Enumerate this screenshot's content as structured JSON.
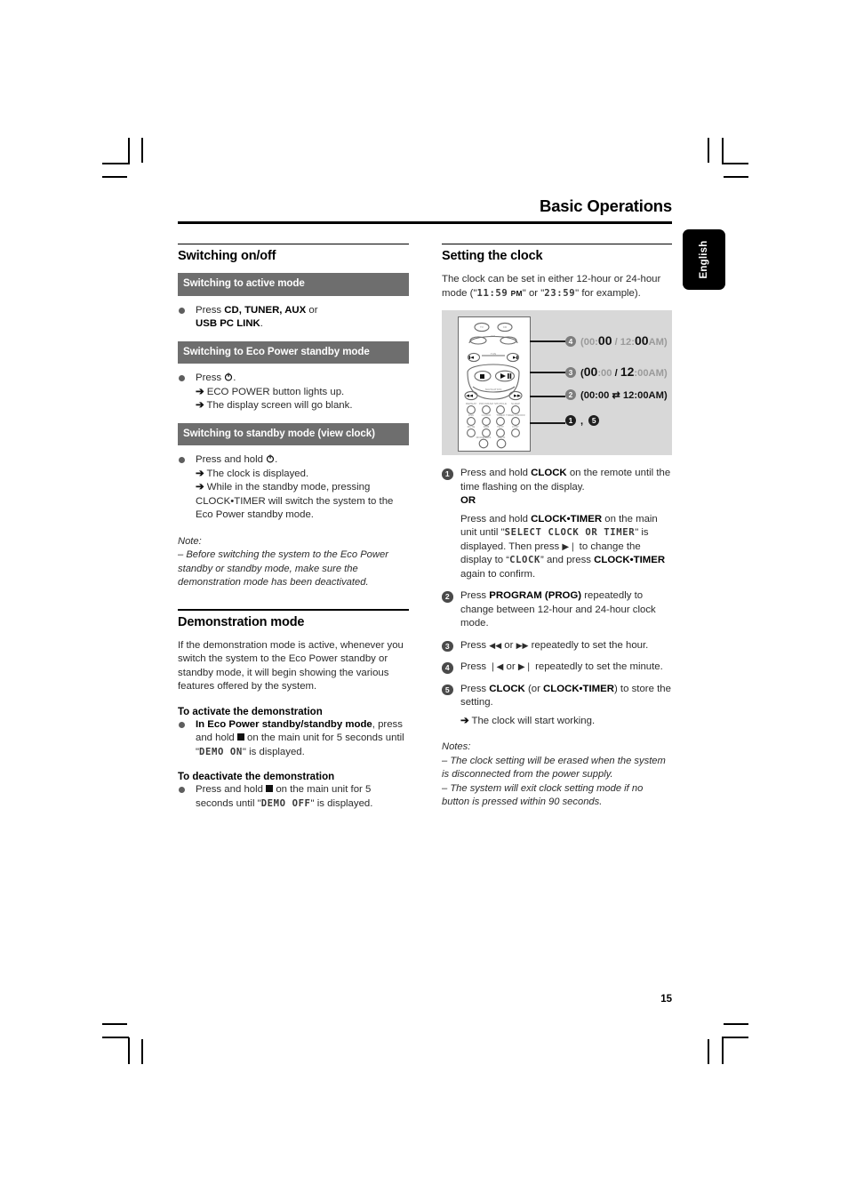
{
  "page": {
    "running_head": "Basic Operations",
    "number": "15",
    "language_tab": "English"
  },
  "left_column": {
    "section_title": "Switching on/off",
    "bars": {
      "active_mode": "Switching to active mode",
      "eco_standby": "Switching to Eco Power standby mode",
      "standby_view_clock": "Switching to standby mode (view clock)"
    },
    "active_mode": {
      "press_label": "Press ",
      "keys": "CD, TUNER, AUX",
      "or": " or",
      "keys2": "USB PC LINK",
      "period": "."
    },
    "eco_standby": {
      "press": "Press ",
      "icon": "power-icon",
      "period": ".",
      "result1": "ECO POWER button lights up.",
      "result2": "The display screen will go blank."
    },
    "standby": {
      "press": "Press and hold ",
      "icon": "power-icon",
      "period": ".",
      "result1": "The clock is displayed.",
      "result2_a": "While in the standby mode, pressing CLOCK",
      "result2_dot": "•",
      "result2_b": "TIMER will switch the system to the Eco Power standby mode."
    },
    "note": {
      "label": "Note:",
      "text": "–  Before switching the system to the Eco Power standby or standby mode, make sure the demonstration mode has been deactivated."
    },
    "demo_section": {
      "title": "Demonstration mode",
      "intro": "If the demonstration mode is active, whenever you switch the system to the Eco Power standby or standby mode, it will begin showing the various features offered by the system.",
      "activate_head": "To activate the demonstration",
      "activate_text_a": "In Eco Power standby/standby mode",
      "activate_text_b": ", press and hold ",
      "activate_text_c": " on the main unit for 5 seconds until \"",
      "activate_lcd": "DEMO ON",
      "activate_text_d": "\" is displayed.",
      "deactivate_head": "To deactivate the demonstration",
      "deactivate_text_a": "Press and hold ",
      "deactivate_text_b": " on the main unit for 5 seconds until \"",
      "deactivate_lcd": "DEMO OFF",
      "deactivate_text_c": "\" is displayed."
    }
  },
  "right_column": {
    "section_title": "Setting the clock",
    "intro_a": "The clock can be set in either 12-hour or 24-hour mode (\"",
    "intro_lcd1": "11:59",
    "intro_pm": "PM",
    "intro_b": "\" or \"",
    "intro_lcd2": "23:59",
    "intro_c": "\" for example).",
    "diagram": {
      "device": "remote-control-illustration",
      "annotations": [
        {
          "num": "4",
          "text": "(00:00 / 12:00AM)",
          "emph": "minutes",
          "style": "num-gray"
        },
        {
          "num": "3",
          "text": "(00:00 / 12:00AM)",
          "emph": "hours",
          "style": "num-gray"
        },
        {
          "num": "2",
          "text": "(00:00 ⇄ 12:00AM)",
          "emph": "toggle",
          "style": "num-gray"
        },
        {
          "num": "1, 5",
          "text": "",
          "emph": "clock",
          "style": "num-dark"
        }
      ]
    },
    "steps": [
      {
        "num": "1",
        "lines": [
          "Press and hold CLOCK on the remote until the time flashing on the display.",
          "OR",
          "Press and hold CLOCK•TIMER on the main unit until \"SELECT CLOCK OR TIMER\" is displayed. Then press ▶❘ to change the display to “CLOCK” and press CLOCK•TIMER again to confirm."
        ]
      },
      {
        "num": "2",
        "lines": [
          "Press PROGRAM (PROG) repeatedly to change between 12-hour and 24-hour clock mode."
        ]
      },
      {
        "num": "3",
        "lines": [
          "Press ◀◀ or ▶▶ repeatedly to set the hour."
        ]
      },
      {
        "num": "4",
        "lines": [
          "Press ❘◀ or ▶❘ repeatedly to set the minute."
        ]
      },
      {
        "num": "5",
        "lines": [
          "Press CLOCK (or CLOCK•TIMER) to store the setting.",
          "The clock will start working."
        ]
      }
    ],
    "notes": {
      "label": "Notes:",
      "n1": "–  The clock setting will be erased when the system is disconnected from the power supply.",
      "n2": "–  The system will exit clock setting mode if no button is pressed within 90 seconds."
    }
  },
  "colors": {
    "bar_gray": "#6e6e6e",
    "diagram_bg": "#d8d8d8",
    "tab_black": "#000000",
    "text": "#2b2b2b"
  }
}
